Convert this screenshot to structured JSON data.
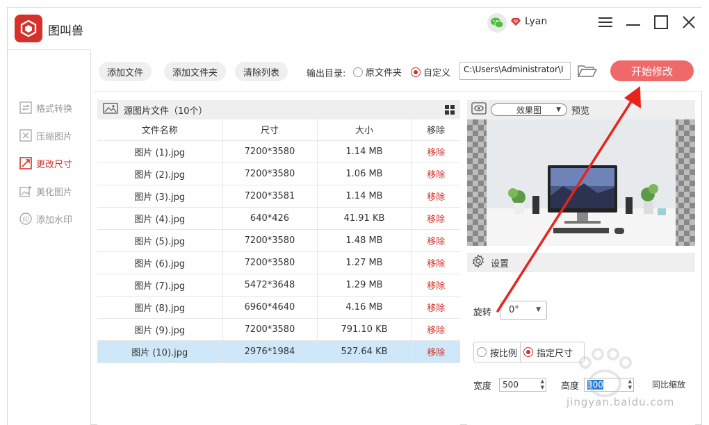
{
  "app": {
    "title": "图叫兽",
    "username": "Lyan"
  },
  "sidebar": {
    "items": [
      {
        "label": "格式转换",
        "icon": "format-convert-icon",
        "active": false
      },
      {
        "label": "压缩图片",
        "icon": "compress-icon",
        "active": false
      },
      {
        "label": "更改尺寸",
        "icon": "resize-icon",
        "active": true
      },
      {
        "label": "美化图片",
        "icon": "beautify-icon",
        "active": false
      },
      {
        "label": "添加水印",
        "icon": "watermark-icon",
        "active": false
      }
    ]
  },
  "toolbar": {
    "add_file": "添加文件",
    "add_folder": "添加文件夹",
    "clear_list": "清除列表",
    "output_label": "输出目录:",
    "opt_original": "原文件夹",
    "opt_custom": "自定义",
    "path_value": "C:\\Users\\Administrator\\I",
    "start": "开始修改"
  },
  "filelist": {
    "header": "源图片文件（10个）",
    "columns": [
      "文件名称",
      "尺寸",
      "大小",
      "移除"
    ],
    "rows": [
      {
        "name": "图片 (1).jpg",
        "dim": "7200*3580",
        "size": "1.14 MB",
        "remove": "移除"
      },
      {
        "name": "图片 (2).jpg",
        "dim": "7200*3580",
        "size": "1.06 MB",
        "remove": "移除"
      },
      {
        "name": "图片 (3).jpg",
        "dim": "7200*3581",
        "size": "1.14 MB",
        "remove": "移除"
      },
      {
        "name": "图片 (4).jpg",
        "dim": "640*426",
        "size": "41.91 KB",
        "remove": "移除"
      },
      {
        "name": "图片 (5).jpg",
        "dim": "7200*3580",
        "size": "1.48 MB",
        "remove": "移除"
      },
      {
        "name": "图片 (6).jpg",
        "dim": "7200*3580",
        "size": "1.27 MB",
        "remove": "移除"
      },
      {
        "name": "图片 (7).jpg",
        "dim": "5472*3648",
        "size": "1.29 MB",
        "remove": "移除"
      },
      {
        "name": "图片 (8).jpg",
        "dim": "6960*4640",
        "size": "4.16 MB",
        "remove": "移除"
      },
      {
        "name": "图片 (9).jpg",
        "dim": "7200*3580",
        "size": "791.10 KB",
        "remove": "移除"
      },
      {
        "name": "图片 (10).jpg",
        "dim": "2976*1984",
        "size": "527.64 KB",
        "remove": "移除"
      }
    ],
    "selected_index": 9
  },
  "preview": {
    "mode": "效果图",
    "label": "预览"
  },
  "settings": {
    "header": "设置",
    "rotate_label": "旋转",
    "rotate_value": "0°",
    "opt_ratio": "按比例",
    "opt_size": "指定尺寸",
    "width_label": "宽度",
    "width_value": "500",
    "height_label": "高度",
    "height_value": "300",
    "keep_ratio": "同比缩放"
  },
  "watermark": "jingyan.baidu.com",
  "colors": {
    "brand": "#d6302a",
    "start_button": "#f0696a",
    "selected_row": "#cfe8f9",
    "arrow": "#e8231a"
  }
}
